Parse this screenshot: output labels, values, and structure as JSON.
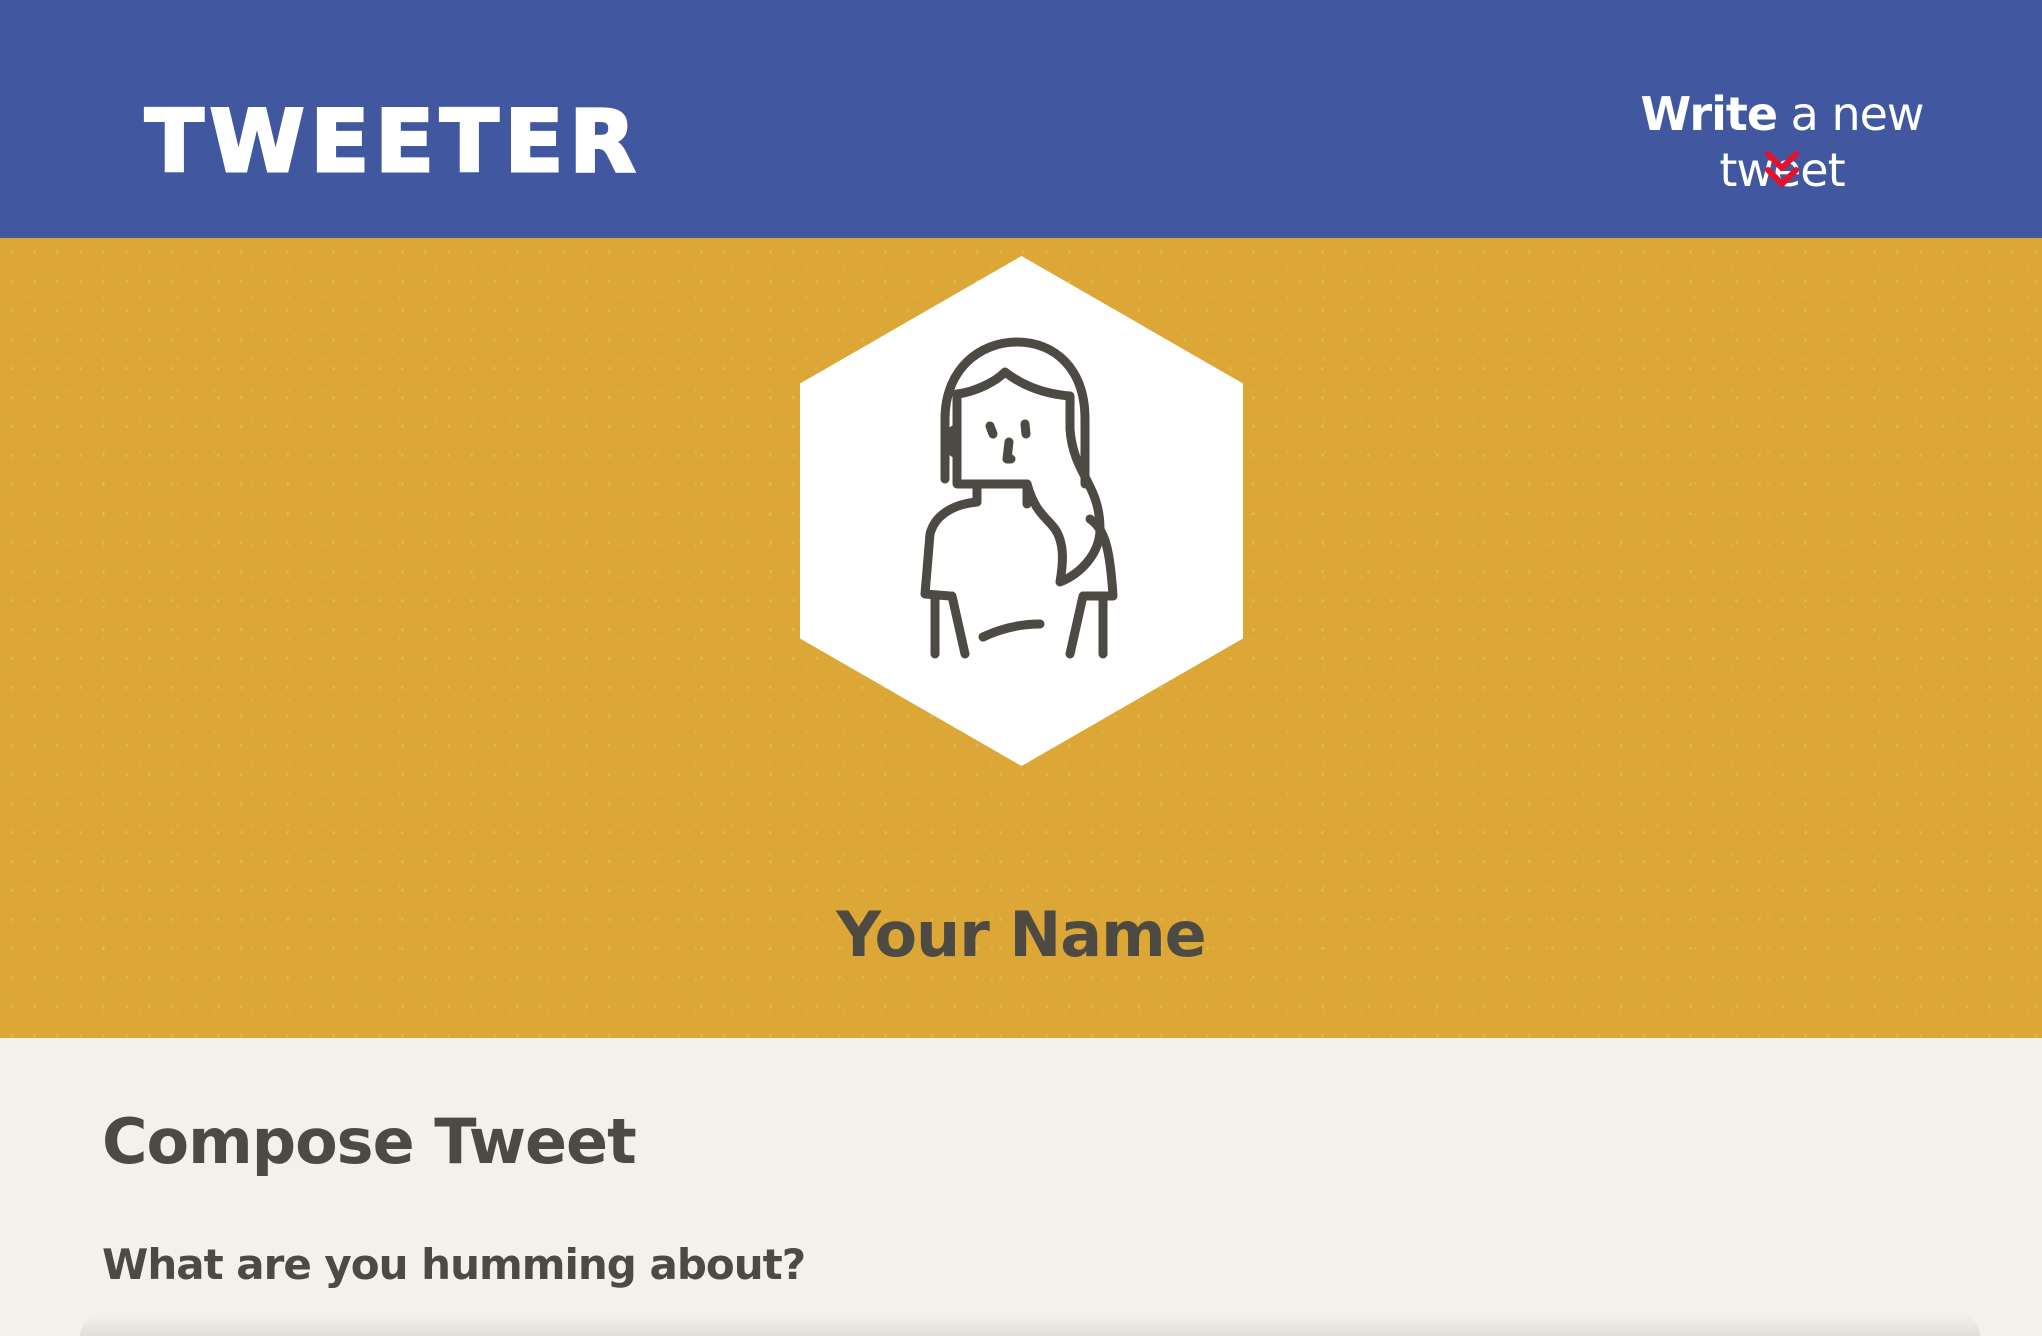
{
  "nav": {
    "brand": "TWEETER",
    "write_strong": "Write",
    "write_light": " a new tweet",
    "chevron_icon": "double-chevron-down-icon",
    "accent_color": "#e8112d",
    "background_color": "#4158a0"
  },
  "profile": {
    "avatar_icon": "person-avatar-icon",
    "name": "Your Name",
    "background_color": "#dca736"
  },
  "compose": {
    "title": "Compose Tweet",
    "label": "What are you humming about?"
  }
}
